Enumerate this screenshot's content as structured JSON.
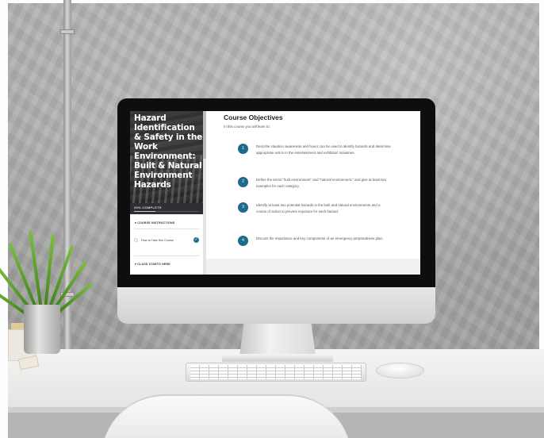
{
  "course": {
    "title": "Hazard Identification & Safety in the Work Environment: Built & Natural Environment Hazards",
    "progress_text": "33% COMPLETE",
    "progress": 0.33,
    "sections": [
      {
        "label": "COURSE INSTRUCTIONS"
      },
      {
        "label": "CLASS STARTS HERE"
      }
    ],
    "lessons": [
      {
        "label": "How to Take this Course",
        "completed": true
      }
    ]
  },
  "objectives": {
    "title": "Course Objectives",
    "intro": "In this course you will learn to:",
    "items": [
      {
        "number": "1",
        "text": "Describe situation awareness and how it can be used to identify hazards and determine appropriate action in the entertainment and exhibition industries."
      },
      {
        "number": "2",
        "text": "Define the terms \"built environment\" and \"natural environment,\" and give at least two examples for each category."
      },
      {
        "number": "3",
        "text": "Identify at least two potential hazards in the built and natural environments and a course of action to prevent exposure for each hazard."
      },
      {
        "number": "4",
        "text": "Discuss the importance and key components of an emergency preparedness plan."
      }
    ]
  },
  "colors": {
    "accent": "#1d6a8a",
    "sidebar_bg": "#2d2f33"
  }
}
